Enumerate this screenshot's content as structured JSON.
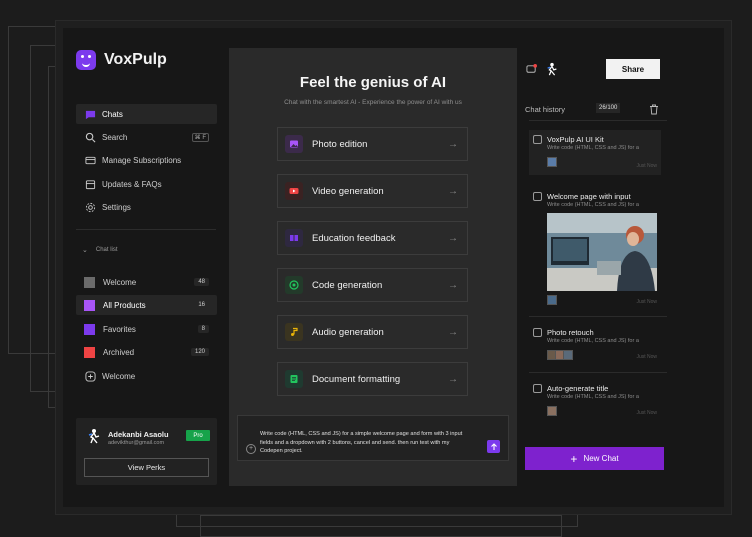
{
  "brand": {
    "name": "VoxPulp"
  },
  "nav": [
    {
      "label": "Chats",
      "icon": "chat-icon"
    },
    {
      "label": "Search",
      "icon": "search-icon",
      "shortcut": "⌘ F"
    },
    {
      "label": "Manage Subscriptions",
      "icon": "card-icon"
    },
    {
      "label": "Updates & FAQs",
      "icon": "calendar-icon"
    },
    {
      "label": "Settings",
      "icon": "gear-icon"
    }
  ],
  "chat_list": {
    "label": "Chat list",
    "items": [
      {
        "label": "Welcome",
        "count": "48",
        "color": "#6b6b6b"
      },
      {
        "label": "All Products",
        "count": "16",
        "color": "#a855f7"
      },
      {
        "label": "Favorites",
        "count": "8",
        "color": "#7c3aed"
      },
      {
        "label": "Archived",
        "count": "120",
        "color": "#ef4444"
      },
      {
        "label": "Welcome",
        "icon": "plus-circle-icon"
      }
    ]
  },
  "user": {
    "name": "Adekanbi Asaolu",
    "email": "adevikthur@gmail.com",
    "badge": "Pro",
    "perks_button": "View Perks"
  },
  "main": {
    "title": "Feel the genius of AI",
    "subtitle": "Chat with the smartest AI - Experience the power of AI with us",
    "features": [
      {
        "label": "Photo edition",
        "icon": "photo-icon",
        "color": "#a855f7",
        "bg": "#3b2a4a"
      },
      {
        "label": "Video generation",
        "icon": "youtube-icon",
        "color": "#ef4444",
        "bg": "#3a2222"
      },
      {
        "label": "Education feedback",
        "icon": "book-icon",
        "color": "#7c3aed",
        "bg": "#2e2840"
      },
      {
        "label": "Code generation",
        "icon": "code-icon",
        "color": "#22c55e",
        "bg": "#233a2a"
      },
      {
        "label": "Audio generation",
        "icon": "music-icon",
        "color": "#eab308",
        "bg": "#3a3420"
      },
      {
        "label": "Document formatting",
        "icon": "document-icon",
        "color": "#22c55e",
        "bg": "#1f3a30"
      }
    ],
    "prompt": "Write code (HTML, CSS and JS) for a simple welcome page and form with 3 input fields and a dropdown with 2 buttons, cancel and send. then run test with my Codepen project."
  },
  "right": {
    "share_label": "Share",
    "history_title": "Chat history",
    "history_count": "26/100",
    "history": [
      {
        "title": "VoxPulp AI UI Kit",
        "snippet": "Write code (HTML, CSS and JS) for a",
        "ago": "Just Now"
      },
      {
        "title": "Welcome page with input",
        "snippet": "Write code (HTML, CSS and JS) for a",
        "ago": "Just Now"
      },
      {
        "title": "Photo retouch",
        "snippet": "Write code (HTML, CSS and JS) for a",
        "ago": "Just Now"
      },
      {
        "title": "Auto-generate title",
        "snippet": "Write code (HTML, CSS and JS) for a",
        "ago": "Just Now"
      }
    ],
    "new_chat_label": "New Chat"
  }
}
